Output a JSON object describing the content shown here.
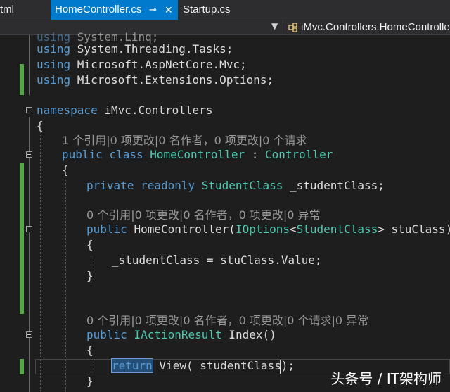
{
  "tabs": [
    {
      "label": "tml",
      "active": false
    },
    {
      "label": "HomeController.cs",
      "active": true,
      "pin_icon": "pin-icon",
      "close_icon": "close-icon"
    },
    {
      "label": "Startup.cs",
      "active": false
    }
  ],
  "navbar": {
    "dropdown_icon": "chevron-down-icon",
    "class_icon": "class-icon",
    "member_path": "iMvc.Controllers.HomeControlle"
  },
  "code": {
    "l0": {
      "t1": "using ",
      "t2": "System.Linq;"
    },
    "l1": {
      "t1": "using ",
      "t2": "System.Threading.Tasks;"
    },
    "l2": {
      "t1": "using ",
      "t2": "Microsoft.AspNetCore.Mvc;"
    },
    "l3": {
      "t1": "using ",
      "t2": "Microsoft.Extensions.Options;"
    },
    "l5": {
      "t1": "namespace ",
      "t2": "iMvc.Controllers"
    },
    "l6": {
      "t1": "{"
    },
    "l7": {
      "lens": "1 个引用|0 项更改|0 名作者，0 项更改|0 个请求"
    },
    "l8": {
      "t1": "public ",
      "t2": "class ",
      "t3": "HomeController",
      "t4": " : ",
      "t5": "Controller"
    },
    "l9": {
      "t1": "{"
    },
    "l10": {
      "t1": "private ",
      "t2": "readonly ",
      "t3": "StudentClass",
      "t4": " _studentClass;"
    },
    "l12": {
      "lens": "0 个引用|0 项更改|0 名作者，0 项更改|0 异常"
    },
    "l13": {
      "t1": "public ",
      "t2": "HomeController(",
      "t3": "IOptions",
      "t4": "<",
      "t5": "StudentClass",
      "t6": "> stuClass)"
    },
    "l14": {
      "t1": "{"
    },
    "l15": {
      "t1": "_studentClass = stuClass.Value;"
    },
    "l16": {
      "t1": "}"
    },
    "l19": {
      "lens": "0 个引用|0 项更改|0 名作者，0 项更改|0 个请求|0 异常"
    },
    "l20": {
      "t1": "public ",
      "t2": "IActionResult",
      "t3": " Index()"
    },
    "l21": {
      "t1": "{"
    },
    "l22": {
      "t1": "return",
      "t2": " View(_studentClass);"
    },
    "l23": {
      "t1": "}"
    }
  },
  "watermark": "头条号 / IT架构师",
  "colors": {
    "keyword": "#569cd6",
    "type": "#4ec9b0",
    "text": "#dcdcdc",
    "lens": "#999999",
    "tab_active": "#007acc",
    "changed_margin": "#57a64a"
  }
}
